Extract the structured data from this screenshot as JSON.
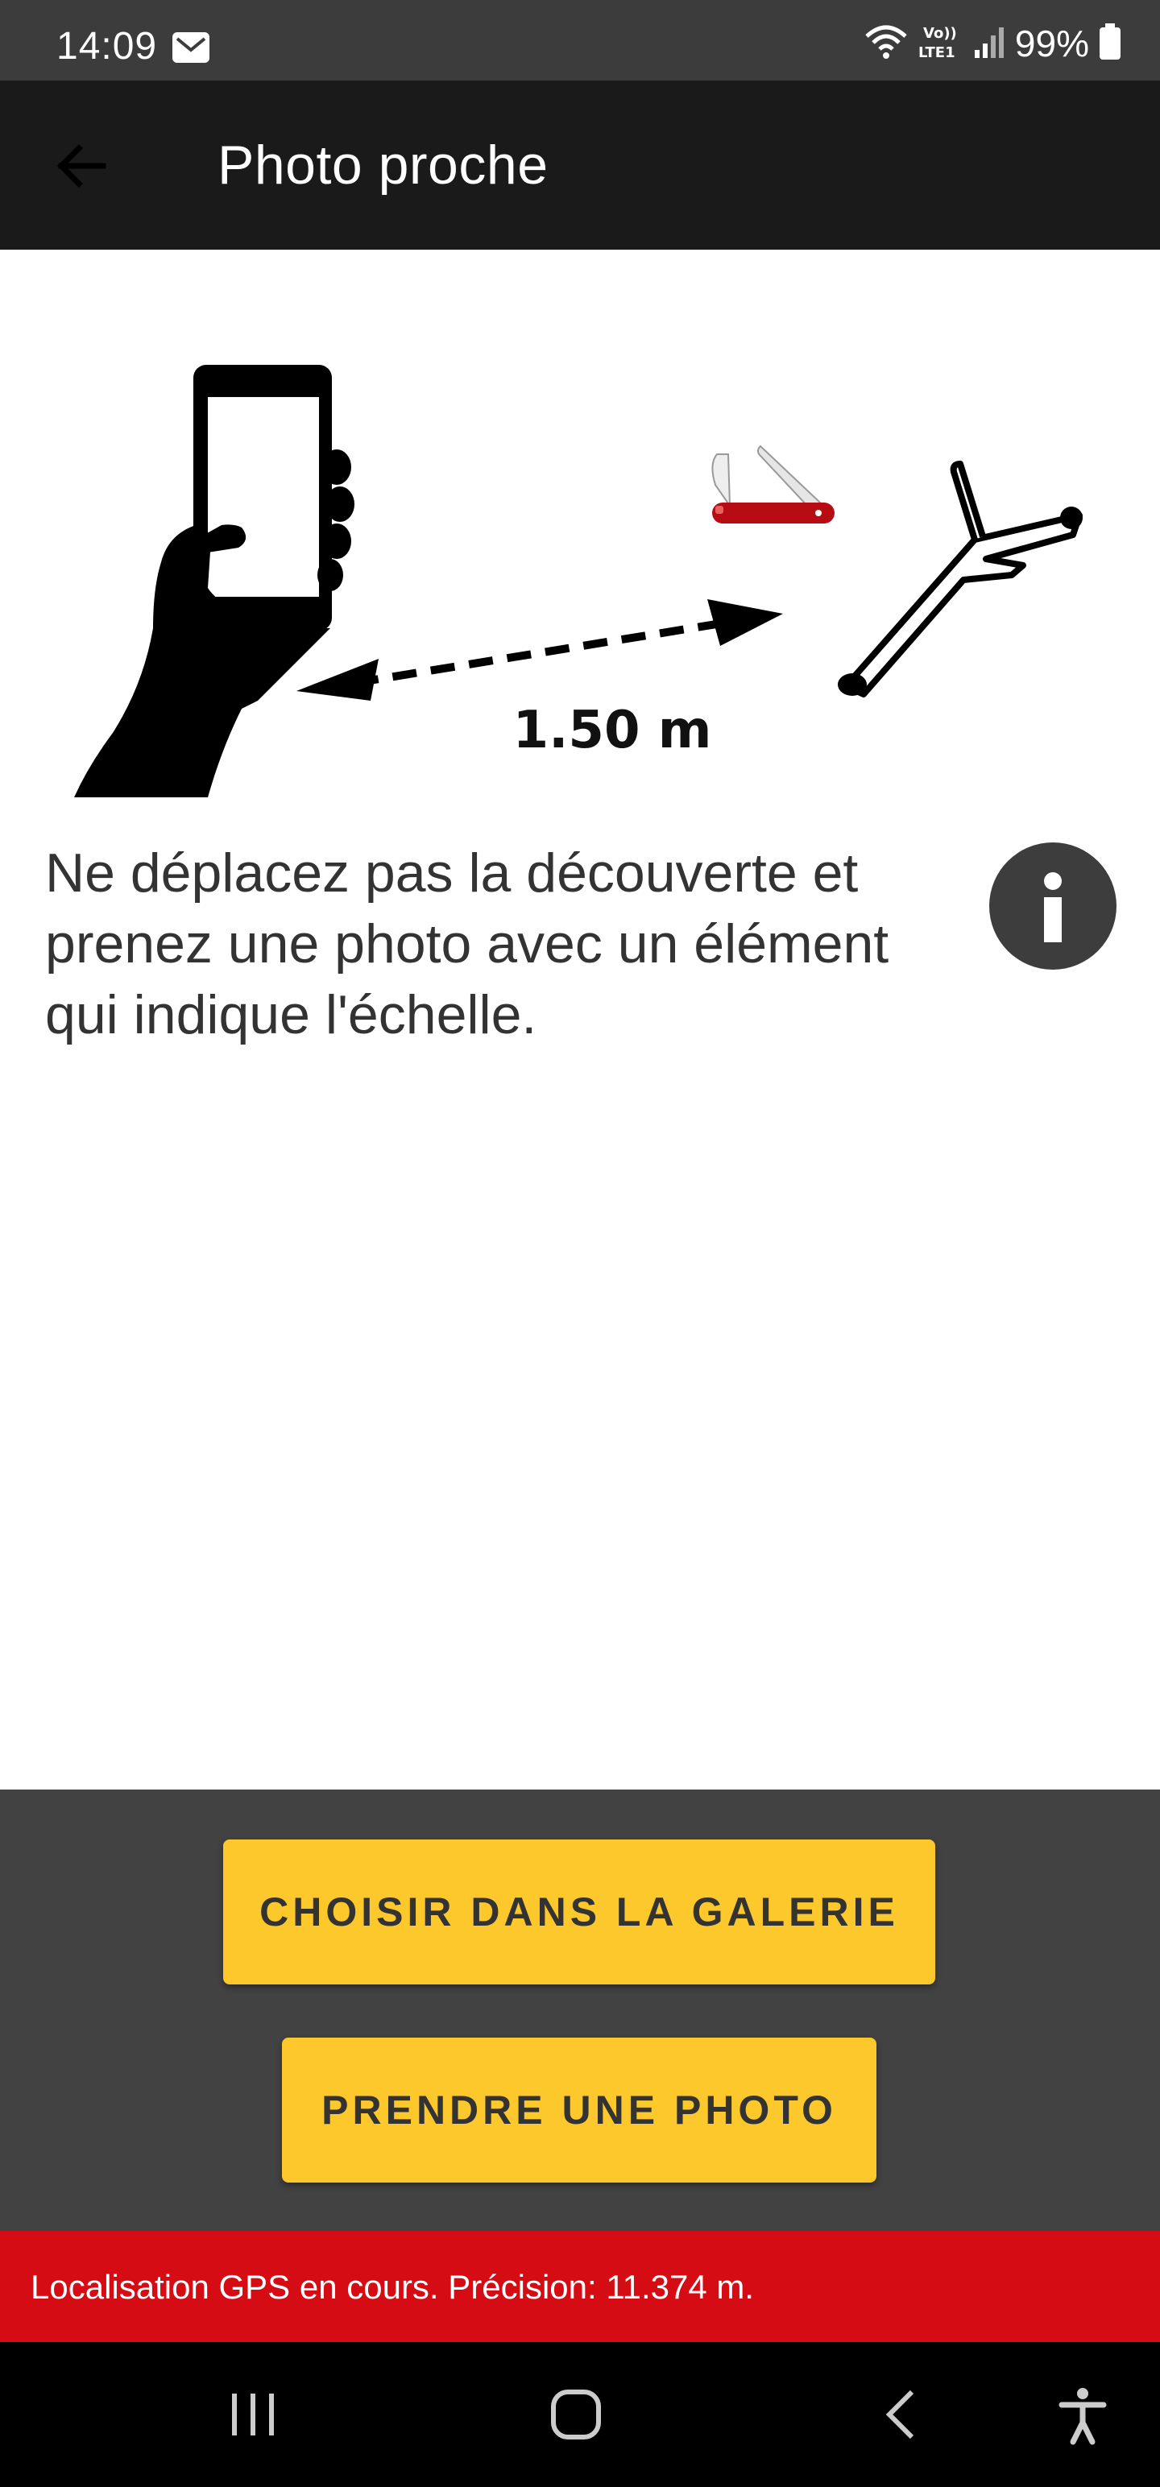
{
  "status_bar": {
    "time": "14:09",
    "battery": "99%",
    "icons": [
      "mail-icon",
      "wifi-icon",
      "volte-icon",
      "signal-icon",
      "battery-icon"
    ]
  },
  "app_bar": {
    "title": "Photo proche",
    "back_icon": "arrow-left-icon"
  },
  "illustration": {
    "distance": "1.50 m",
    "icons": [
      "hand-holding-phone-icon",
      "double-arrow-icon",
      "pocket-knife-icon",
      "branch-icon"
    ]
  },
  "instruction": {
    "text": "Ne déplacez pas la découverte et prenez une photo avec un élément qui indique l'échelle.",
    "info_icon": "info-icon"
  },
  "actions": {
    "gallery_label": "CHOISIR DANS LA GALERIE",
    "photo_label": "PRENDRE UNE PHOTO"
  },
  "gps": {
    "message": "Localisation GPS en cours. Précision: 11.374 m."
  },
  "nav_bar": {
    "icons": [
      "recent-apps-icon",
      "home-icon",
      "back-icon",
      "accessibility-icon"
    ]
  },
  "colors": {
    "accent": "#fcc82b",
    "alert": "#d50c14",
    "app_bar": "#1a1a1a",
    "panel": "#424242"
  }
}
